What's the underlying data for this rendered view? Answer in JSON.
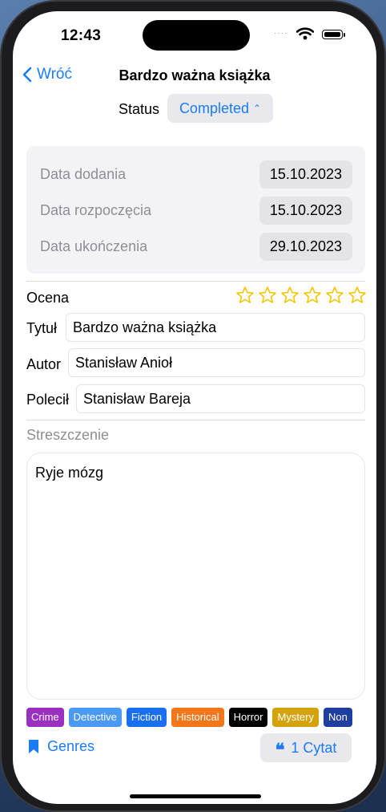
{
  "status_bar": {
    "time": "12:43",
    "signal": "····"
  },
  "nav": {
    "back_label": "Wróć",
    "title": "Bardzo ważna książka"
  },
  "status": {
    "label": "Status",
    "value": "Completed"
  },
  "dates": [
    {
      "label": "Data dodania",
      "value": "15.10.2023"
    },
    {
      "label": "Data rozpoczęcia",
      "value": "15.10.2023"
    },
    {
      "label": "Data ukończenia",
      "value": "29.10.2023"
    }
  ],
  "rating": {
    "label": "Ocena",
    "max": 6,
    "value": 0,
    "star_color": "#f5c400"
  },
  "fields": {
    "title": {
      "label": "Tytuł",
      "value": "Bardzo ważna książka"
    },
    "author": {
      "label": "Autor",
      "value": "Stanisław Anioł"
    },
    "recommended": {
      "label": "Polecił",
      "value": "Stanisław Bareja"
    }
  },
  "summary": {
    "label": "Streszczenie",
    "text": "Ryje mózg"
  },
  "genres_list": [
    {
      "name": "Crime",
      "color": "#9b2fbf"
    },
    {
      "name": "Detective",
      "color": "#4a9af5"
    },
    {
      "name": "Fiction",
      "color": "#1a6ff0"
    },
    {
      "name": "Historical",
      "color": "#f2761a"
    },
    {
      "name": "Horror",
      "color": "#000000"
    },
    {
      "name": "Mystery",
      "color": "#d4a20a"
    },
    {
      "name": "Non",
      "color": "#1f3fa0"
    }
  ],
  "footer": {
    "genres_label": "Genres",
    "quotes_label": "1 Cytat"
  },
  "accent": "#1a7cf5"
}
